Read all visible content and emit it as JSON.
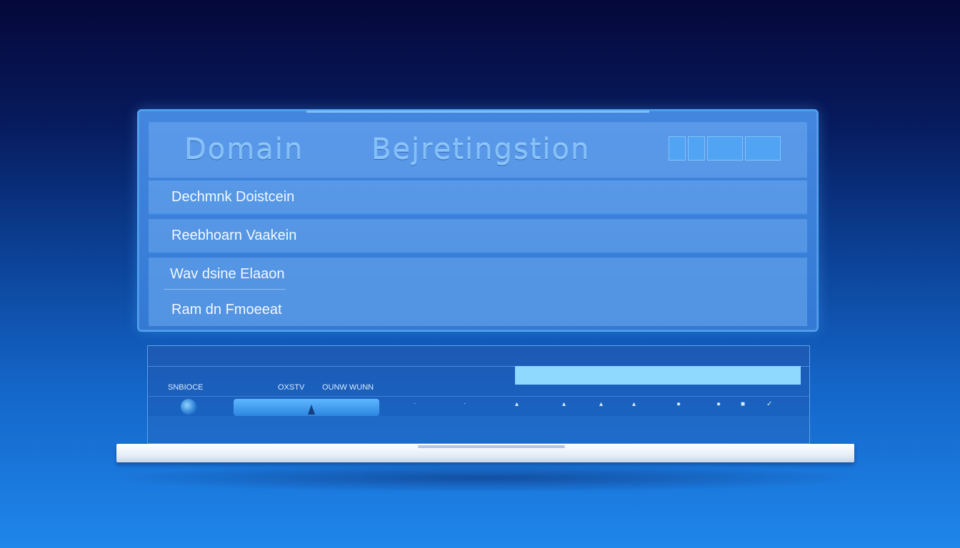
{
  "header": {
    "title_left": "Domain",
    "title_right": "Bejretingstion"
  },
  "rows": [
    {
      "label": "Dechmnk Doistcein"
    },
    {
      "label": "Reebhoarn Vaakein"
    },
    {
      "label": "Wav dsine Elaaon"
    },
    {
      "label": "Ram dn Fmoeeat"
    }
  ],
  "lower_panel": {
    "labels": [
      "SNBIOCE",
      "OXSTV",
      "OUNW WUNN"
    ],
    "input_value": "",
    "tick_icons": [
      "dot-icon",
      "dot-icon",
      "dot-icon",
      "dot-icon",
      "dot-icon",
      "dot-icon",
      "circle-icon",
      "circle-icon",
      "square-icon",
      "check-icon"
    ]
  },
  "colors": {
    "background_top": "#05083a",
    "background_bottom": "#1f86ea",
    "panel": "#468ce6",
    "input_fill": "#8fd9ff",
    "base": "#f2f5fa"
  }
}
